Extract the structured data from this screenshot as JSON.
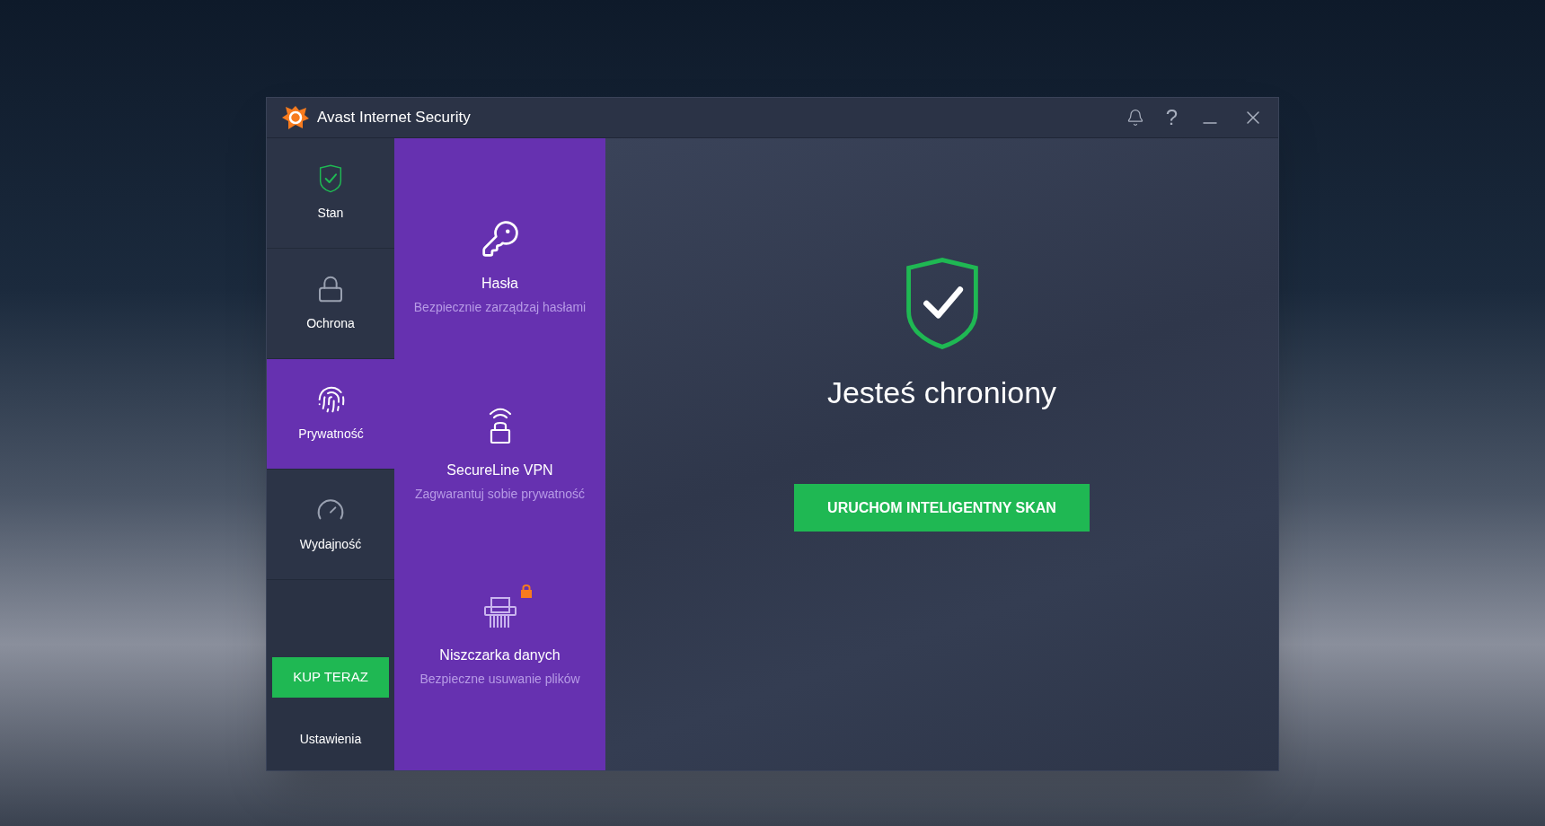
{
  "window": {
    "title": "Avast Internet Security",
    "help_glyph": "?"
  },
  "nav": [
    {
      "label": "Stan",
      "selected": false
    },
    {
      "label": "Ochrona",
      "selected": false
    },
    {
      "label": "Prywatność",
      "selected": true
    },
    {
      "label": "Wydajność",
      "selected": false
    }
  ],
  "buy_button": "KUP TERAZ",
  "settings": "Ustawienia",
  "features": [
    {
      "title": "Hasła",
      "subtitle": "Bezpiecznie zarządzaj hasłami",
      "locked": false
    },
    {
      "title": "SecureLine VPN",
      "subtitle": "Zagwarantuj sobie prywatność",
      "locked": false
    },
    {
      "title": "Niszczarka danych",
      "subtitle": "Bezpieczne usuwanie plików",
      "locked": true
    }
  ],
  "status": {
    "headline": "Jesteś chroniony",
    "scan_button": "URUCHOM INTELIGENTNY SKAN"
  }
}
